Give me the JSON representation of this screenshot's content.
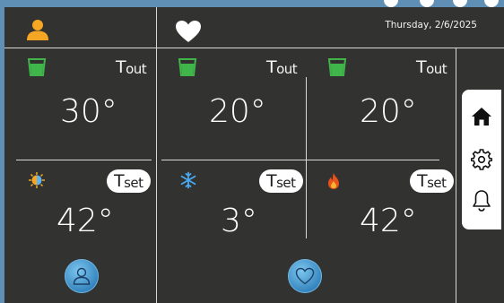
{
  "header": {
    "date_text": "Thursday, 2/6/2025",
    "user_icon": "person-icon",
    "favorite_icon": "heart-icon"
  },
  "colors": {
    "background": "#323231",
    "accent_orange": "#f5a623",
    "cup_green": "#3fb54a",
    "button_blue": "#2f7fba",
    "side_panel": "#ffffff"
  },
  "zones": [
    {
      "id": "left",
      "tout_label": "T",
      "tout_sub": "out",
      "tout_value": "30°",
      "tset_label": "T",
      "tset_sub": "set",
      "tset_value": "42°",
      "mode_icon": "sun-snow-auto-icon",
      "profile_icon": "person-icon"
    },
    {
      "id": "middle",
      "tout_label": "T",
      "tout_sub": "out",
      "tout_value": "20°",
      "tset_label": "T",
      "tset_sub": "set",
      "tset_value": "3°",
      "mode_icon": "snowflake-icon",
      "profile_icon": "heart-icon"
    },
    {
      "id": "right",
      "tout_label": "T",
      "tout_sub": "out",
      "tout_value": "20°",
      "tset_label": "T",
      "tset_sub": "set",
      "tset_value": "42°",
      "mode_icon": "flame-icon"
    }
  ],
  "side_nav": [
    {
      "name": "home",
      "icon": "home-icon"
    },
    {
      "name": "settings",
      "icon": "gear-icon"
    },
    {
      "name": "notifications",
      "icon": "bell-icon"
    }
  ]
}
